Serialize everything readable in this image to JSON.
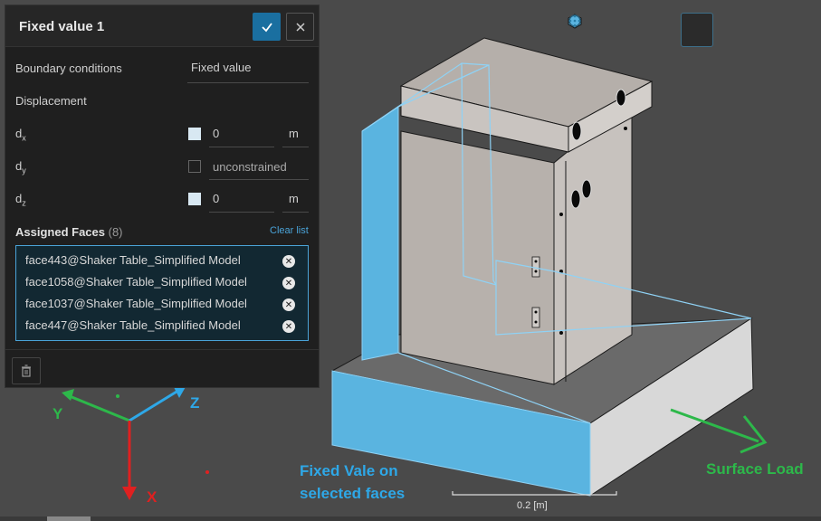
{
  "panel": {
    "title": "Fixed value 1",
    "boundary_label": "Boundary conditions",
    "boundary_value": "Fixed value",
    "displacement_label": "Displacement",
    "dx": {
      "label": "d",
      "sub": "x",
      "value": "0",
      "unit": "m",
      "checked": true
    },
    "dy": {
      "label": "d",
      "sub": "y",
      "value": "unconstrained",
      "checked": false
    },
    "dz": {
      "label": "d",
      "sub": "z",
      "value": "0",
      "unit": "m",
      "checked": true
    },
    "assigned_label": "Assigned Faces",
    "assigned_count": "(8)",
    "clear_list": "Clear list",
    "faces": [
      "face443@Shaker Table_Simplified Model",
      "face1058@Shaker Table_Simplified Model",
      "face1037@Shaker Table_Simplified Model",
      "face447@Shaker Table_Simplified Model"
    ]
  },
  "annotations": {
    "axis_x": "X",
    "axis_y": "Y",
    "axis_z": "Z",
    "fixed_line1": "Fixed Vale on",
    "fixed_line2": "selected faces",
    "surface_load": "Surface Load"
  },
  "scale": "0.2 [m]",
  "colors": {
    "accent": "#1a6fa0",
    "selection": "#5ab4e0",
    "annotation_blue": "#2ea8e8",
    "annotation_green": "#2db84a",
    "annotation_red": "#e02020"
  },
  "toolbar_icons": [
    "view-cube-outline-icon",
    "view-cube-solid-icon",
    "view-cube-shaded-icon",
    "view-cube-active-icon",
    "mesh-icon",
    "points-icon"
  ]
}
